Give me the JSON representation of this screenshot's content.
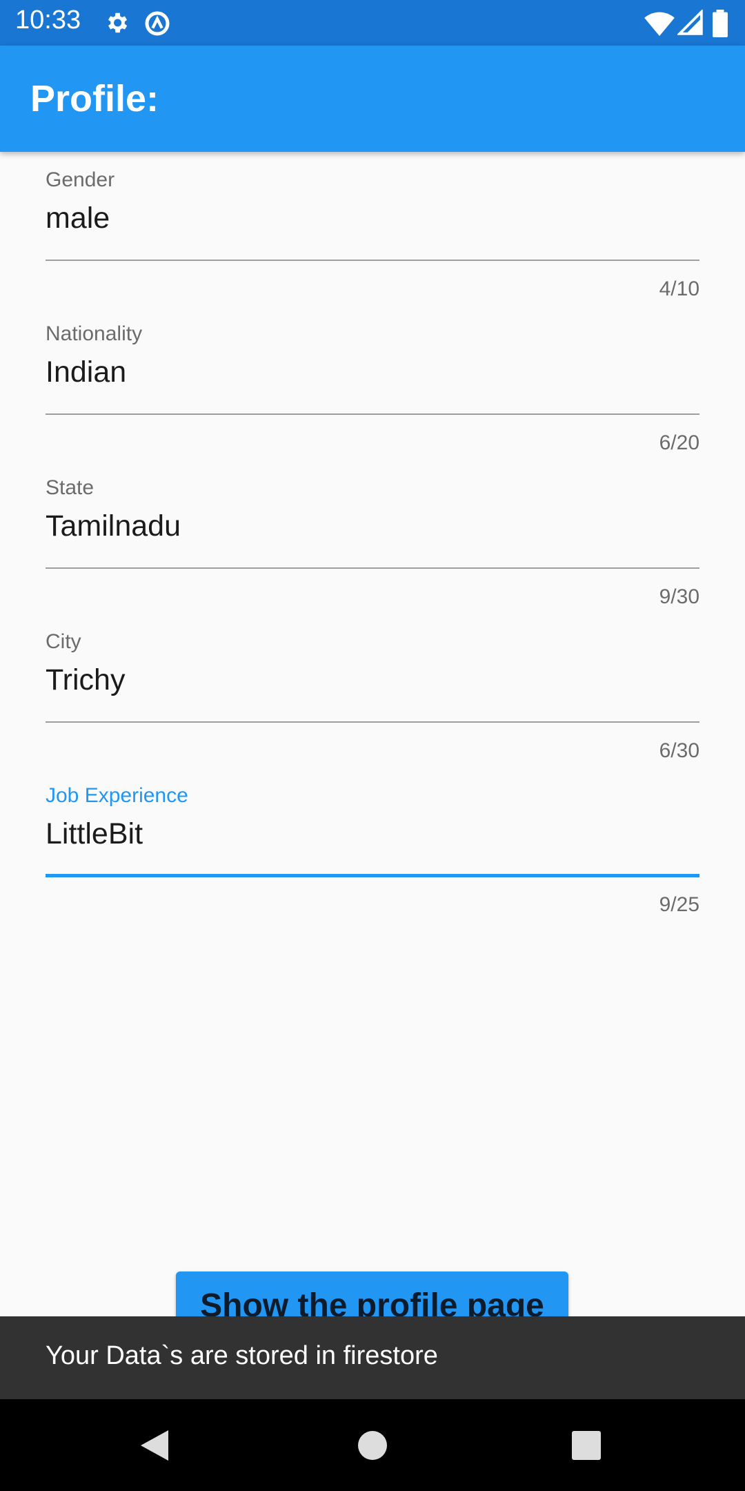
{
  "status_bar": {
    "time": "10:33",
    "icons": [
      "gear-icon",
      "circle-a-icon",
      "wifi-icon",
      "signal-icon",
      "battery-icon"
    ]
  },
  "app_bar": {
    "title": "Profile:"
  },
  "fields": [
    {
      "label": "Gender",
      "value": "male",
      "counter": "4/10"
    },
    {
      "label": "Nationality",
      "value": "Indian",
      "counter": "6/20"
    },
    {
      "label": "State",
      "value": "Tamilnadu",
      "counter": "9/30"
    },
    {
      "label": "City",
      "value": "Trichy",
      "counter": "6/30"
    },
    {
      "label": "Job Experience",
      "value": "LittleBit",
      "counter": "9/25"
    }
  ],
  "show_button": {
    "label": "Show the profile page"
  },
  "snackbar": {
    "message": "Your Data`s are stored in firestore"
  },
  "nav": {
    "icons": [
      "back-icon",
      "home-icon",
      "recents-icon"
    ]
  },
  "colors": {
    "primary": "#2196f3",
    "status_bar": "#1976d2",
    "snackbar": "#323232"
  }
}
